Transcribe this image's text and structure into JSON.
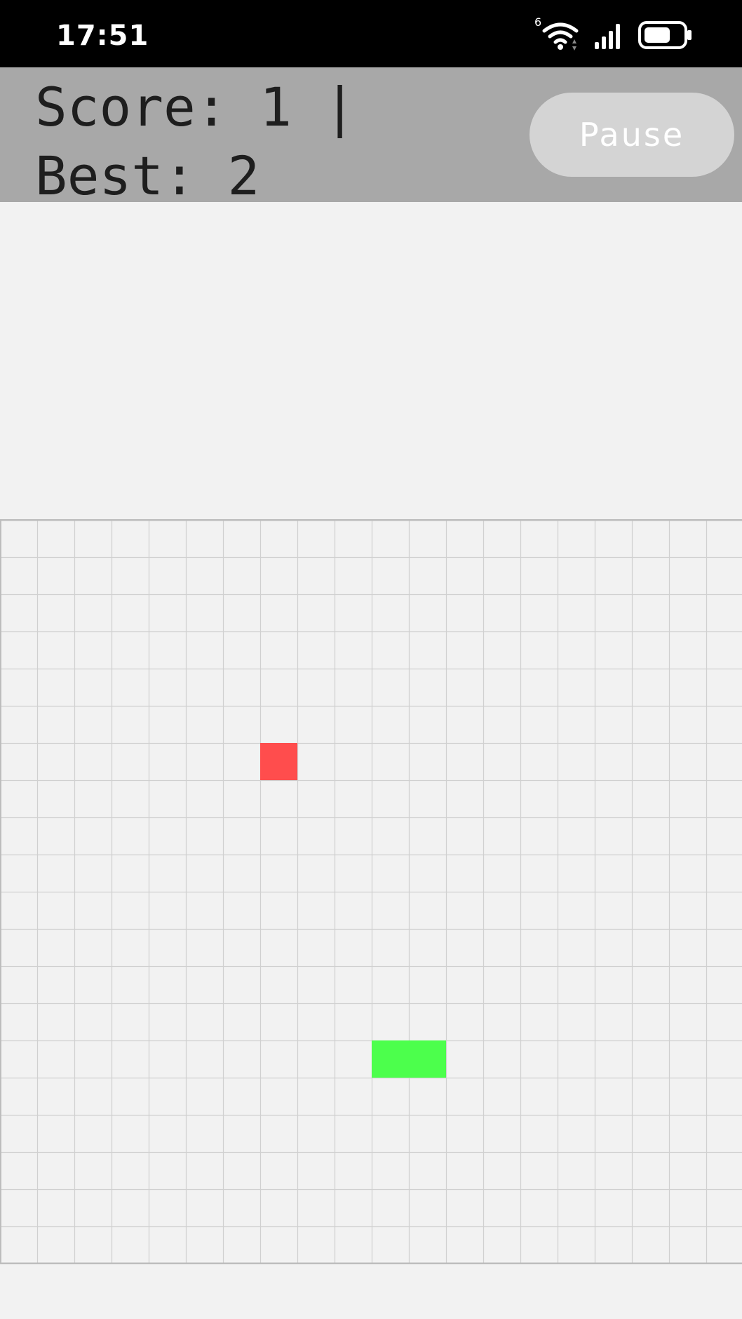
{
  "status_bar": {
    "time": "17:51",
    "icons": [
      "wifi-icon",
      "signal-icon",
      "battery-icon"
    ],
    "wifi_badge": "6"
  },
  "header": {
    "score_text": "Score: 1 | Best: 2",
    "pause_label": "Pause"
  },
  "game": {
    "grid": {
      "cols": 20,
      "rows": 20
    },
    "food": {
      "col": 7,
      "row": 6,
      "color": "#ff4d4d"
    },
    "snake": {
      "color": "#4cff4c",
      "segments": [
        {
          "col": 10,
          "row": 14
        },
        {
          "col": 11,
          "row": 14
        }
      ]
    },
    "colors": {
      "background": "#f2f2f2",
      "grid_line": "#d0d0d0",
      "border": "#bdbdbd",
      "header": "#a8a8a8"
    }
  }
}
